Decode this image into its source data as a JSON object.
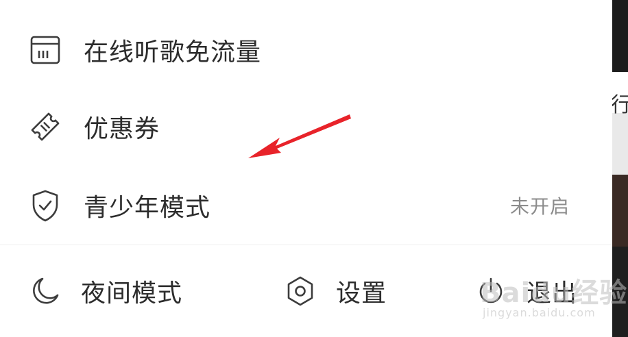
{
  "menu": {
    "items": [
      {
        "label": "在线听歌免流量",
        "icon": "sim-card-icon"
      },
      {
        "label": "优惠券",
        "icon": "ticket-icon"
      },
      {
        "label": "青少年模式",
        "icon": "shield-check-icon",
        "value": "未开启"
      }
    ]
  },
  "bottom_bar": {
    "night_mode_label": "夜间模式",
    "settings_label": "设置",
    "logout_label": "退出"
  },
  "watermark": {
    "main": "Baidu经验",
    "sub": "jingyan.baidu.com"
  },
  "background_peek": "行"
}
